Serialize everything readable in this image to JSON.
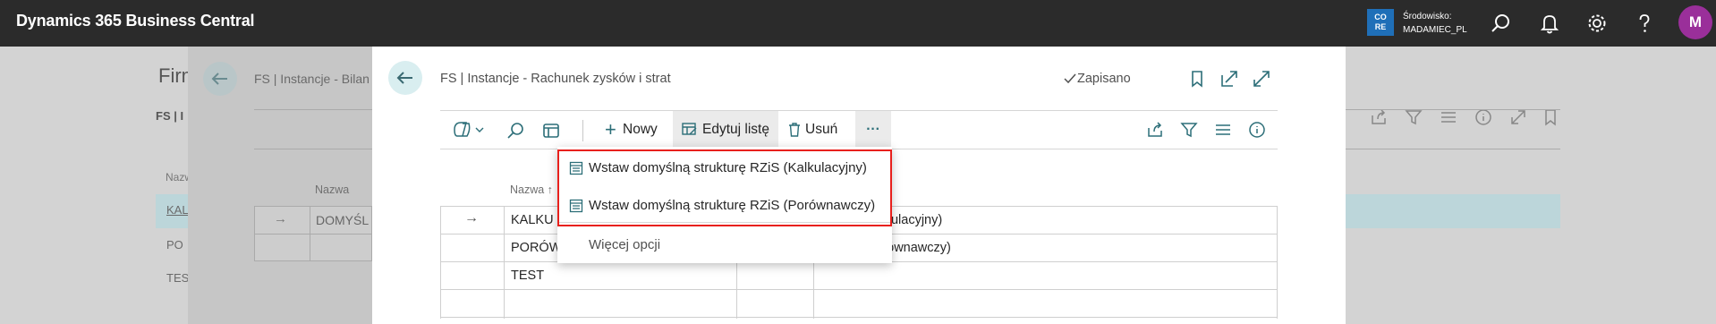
{
  "topbar": {
    "app_title": "Dynamics 365 Business Central",
    "env_badge_line1": "CO",
    "env_badge_line2": "RE",
    "env_label": "Środowisko:",
    "env_name": "MADAMIEC_PL",
    "avatar_initial": "M",
    "accent_color": "#9a2f9a"
  },
  "background_page": {
    "title": "Firm",
    "breadcrumb": "FS | Instancje - Bilan",
    "fs_label": "FS | I",
    "name_header_short": "Nazw",
    "column_name_header": "Nazwa",
    "row_values": [
      "KALK",
      "PO",
      "TES"
    ],
    "selected_row_value": "DOMYŚL"
  },
  "panel": {
    "breadcrumb": "FS | Instancje - Rachunek zysków i strat",
    "saved_label": "Zapisano",
    "actions": {
      "new_label": "Nowy",
      "edit_list_label": "Edytuj listę",
      "delete_label": "Usuń",
      "more_label": "···"
    },
    "grid": {
      "name_header": "Nazwa ↑",
      "rows": [
        {
          "arrow": "→",
          "name": "KALKU",
          "description": "yników (kalkulacyjny)"
        },
        {
          "arrow": "",
          "name": "PORÓW",
          "description": "yników (porównawczy)"
        },
        {
          "arrow": "",
          "name": "TEST",
          "description": ""
        },
        {
          "arrow": "",
          "name": "",
          "description": ""
        }
      ]
    }
  },
  "dropdown": {
    "items": [
      {
        "label": "Wstaw domyślną strukturę RZiS (Kalkulacyjny)",
        "icon": "list-icon"
      },
      {
        "label": "Wstaw domyślną strukturę RZiS (Porównawczy)",
        "icon": "list-icon"
      }
    ],
    "more_options_label": "Więcej opcji",
    "highlight_color": "#e8201c"
  }
}
